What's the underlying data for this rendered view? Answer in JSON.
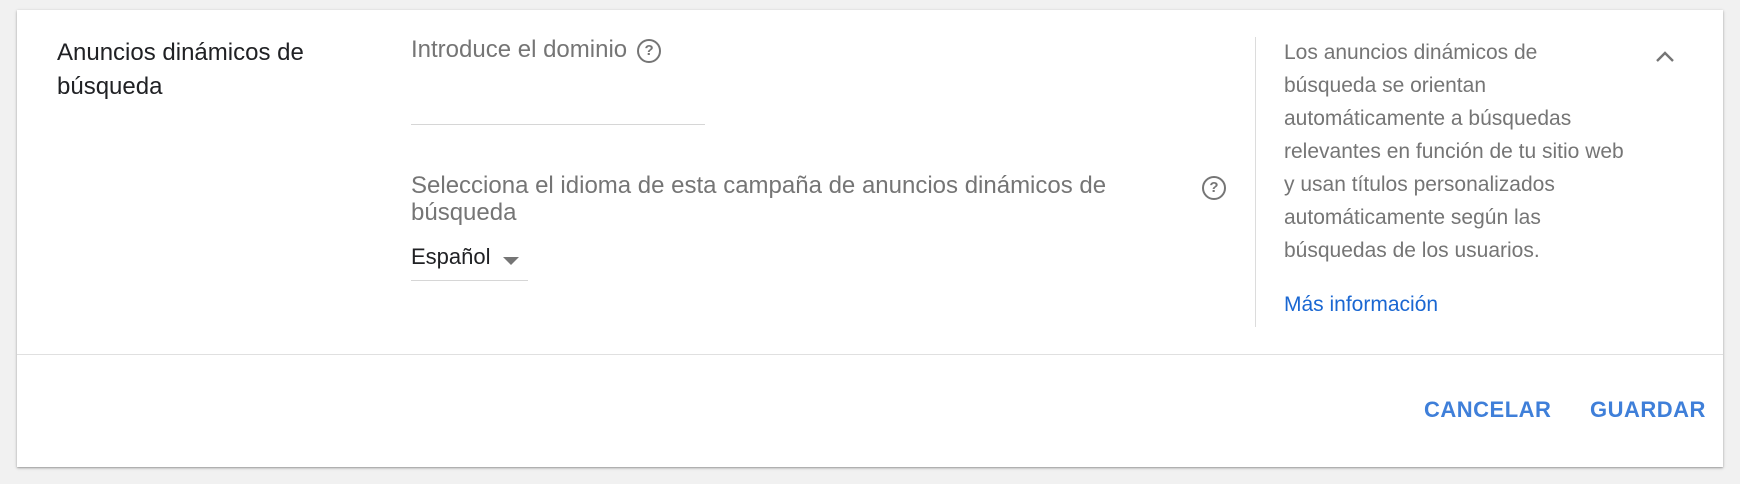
{
  "section": {
    "title": "Anuncios dinámicos de búsqueda"
  },
  "domain_field": {
    "label": "Introduce el dominio",
    "value": "",
    "help_icon": "help-circle-icon"
  },
  "language_field": {
    "label": "Selecciona el idioma de esta campaña de anuncios dinámicos de búsqueda",
    "selected": "Español",
    "help_icon": "help-circle-icon"
  },
  "help_panel": {
    "text": "Los anuncios dinámicos de búsqueda se orientan automáticamente a búsquedas relevantes en función de tu sitio web y usan títulos personalizados automáticamente según las búsquedas de los usuarios.",
    "link": "Más información",
    "collapse_icon": "chevron-up-icon"
  },
  "actions": {
    "cancel": "CANCELAR",
    "save": "GUARDAR"
  },
  "colors": {
    "accent": "#3f7fd9",
    "link": "#1a67d2",
    "muted_text": "#757575"
  }
}
